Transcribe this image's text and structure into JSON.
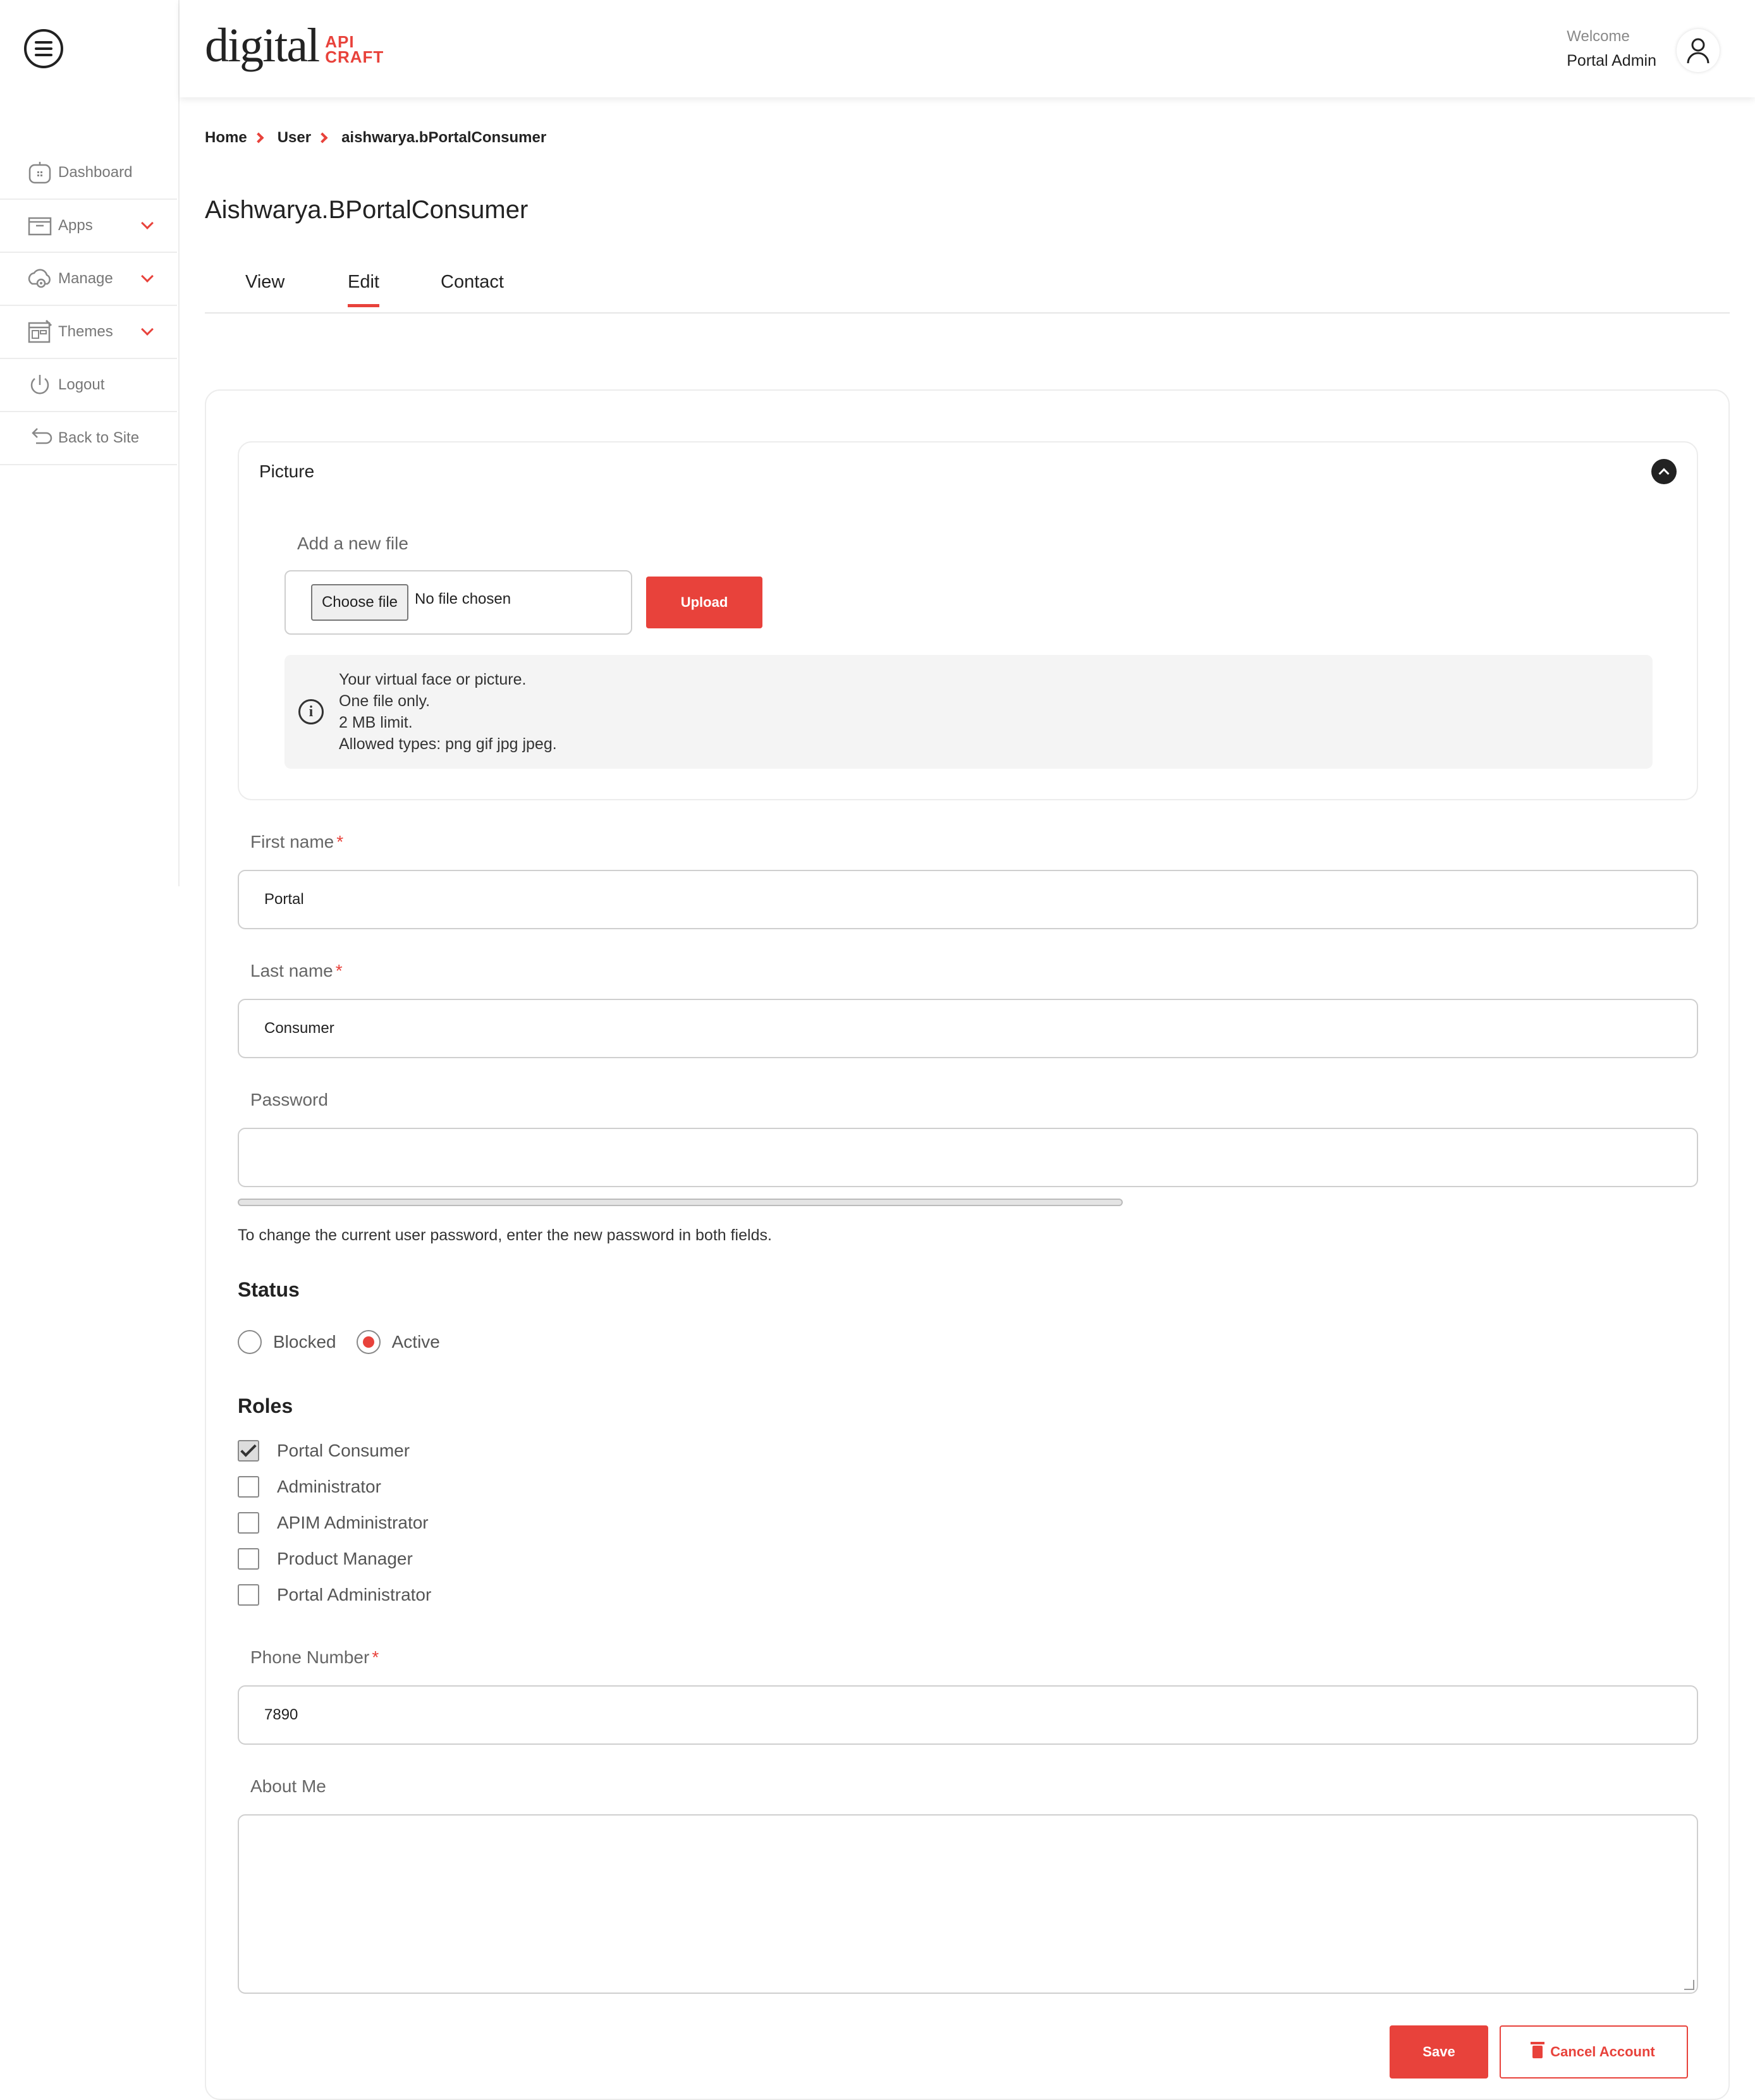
{
  "header": {
    "logo_main": "digital",
    "logo_sub_line1": "API",
    "logo_sub_line2": "CRAFT",
    "welcome_label": "Welcome",
    "user_name": "Portal Admin"
  },
  "sidebar": {
    "items": [
      {
        "label": "Dashboard",
        "icon": "dashboard-icon",
        "has_dropdown": false
      },
      {
        "label": "Apps",
        "icon": "apps-icon",
        "has_dropdown": true
      },
      {
        "label": "Manage",
        "icon": "manage-icon",
        "has_dropdown": true
      },
      {
        "label": "Themes",
        "icon": "themes-icon",
        "has_dropdown": true
      },
      {
        "label": "Logout",
        "icon": "power-icon",
        "has_dropdown": false
      },
      {
        "label": "Back to Site",
        "icon": "back-arrow-icon",
        "has_dropdown": false
      }
    ]
  },
  "breadcrumb": [
    "Home",
    "User",
    "aishwarya.bPortalConsumer"
  ],
  "page_title": "Aishwarya.BPortalConsumer",
  "tabs": [
    {
      "label": "View",
      "active": false
    },
    {
      "label": "Edit",
      "active": true
    },
    {
      "label": "Contact",
      "active": false
    }
  ],
  "picture": {
    "title": "Picture",
    "add_file_label": "Add a new file",
    "choose_file_label": "Choose file",
    "no_file_text": "No file chosen",
    "upload_label": "Upload",
    "info_lines": [
      "Your virtual face or picture.",
      "One file only.",
      "2 MB limit.",
      "Allowed types: png gif jpg jpeg."
    ]
  },
  "form": {
    "first_name": {
      "label": "First name",
      "required_mark": "*",
      "value": "Portal"
    },
    "last_name": {
      "label": "Last name",
      "required_mark": "*",
      "value": "Consumer"
    },
    "password": {
      "label": "Password",
      "value": "",
      "help": "To change the current user password, enter the new password in both fields."
    },
    "status": {
      "heading": "Status",
      "options": [
        "Blocked",
        "Active"
      ],
      "selected": "Active"
    },
    "roles": {
      "heading": "Roles",
      "items": [
        {
          "label": "Portal Consumer",
          "checked": true
        },
        {
          "label": "Administrator",
          "checked": false
        },
        {
          "label": "APIM Administrator",
          "checked": false
        },
        {
          "label": "Product Manager",
          "checked": false
        },
        {
          "label": "Portal Administrator",
          "checked": false
        }
      ]
    },
    "phone": {
      "label": "Phone Number",
      "required_mark": "*",
      "value": "7890"
    },
    "about": {
      "label": "About Me",
      "value": ""
    }
  },
  "actions": {
    "save_label": "Save",
    "cancel_label": "Cancel Account"
  },
  "colors": {
    "accent": "#e8423b",
    "text": "#222222",
    "muted": "#777777"
  }
}
